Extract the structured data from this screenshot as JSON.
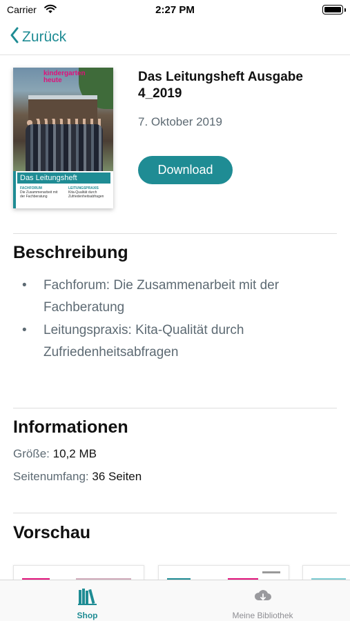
{
  "status_bar": {
    "carrier": "Carrier",
    "time": "2:27 PM"
  },
  "navbar": {
    "back_label": "Zurück"
  },
  "issue": {
    "cover_logo_line1": "kindergarten",
    "cover_logo_line2": "heute",
    "cover_title": "Das Leitungsheft",
    "cover_col1_head": "FACHFORUM",
    "cover_col1_text": "Die Zusammenarbeit mit der Fachberatung",
    "cover_col2_head": "LEITUNGSPRAXIS",
    "cover_col2_text": "Kita-Qualität durch Zufriedenheitsabfragen",
    "title": "Das Leitungsheft Ausgabe 4_2019",
    "date": "7. Oktober 2019",
    "download_label": "Download"
  },
  "description": {
    "heading": "Beschreibung",
    "items": [
      "Fachforum: Die Zusammenarbeit mit der Fachberatung",
      "Leitungspraxis: Kita-Qualität durch Zufriedenheitsabfragen"
    ]
  },
  "information": {
    "heading": "Informationen",
    "size_label": "Größe:",
    "size_value": "10,2 MB",
    "pages_label": "Seitenumfang:",
    "pages_value": "36 Seiten"
  },
  "preview": {
    "heading": "Vorschau"
  },
  "tabbar": {
    "shop_label": "Shop",
    "library_label": "Meine Bibliothek"
  },
  "colors": {
    "accent": "#1f8c94",
    "muted_text": "#5d6a73",
    "inactive_tab": "#8e8e93"
  },
  "icons": {
    "wifi": "wifi-icon",
    "battery": "battery-icon",
    "back": "chevron-left-icon",
    "shop": "books-icon",
    "library": "cloud-download-icon"
  }
}
